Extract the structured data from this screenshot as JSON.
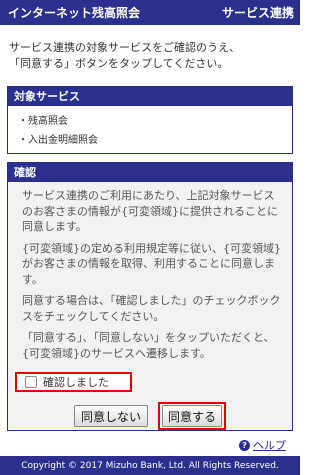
{
  "header": {
    "title": "インターネット残高照会",
    "right_label": "サービス連携"
  },
  "intro": {
    "line1": "サービス連携の対象サービスをご確認のうえ、",
    "line2": "「同意する」ボタンをタップしてください。"
  },
  "services_panel": {
    "heading": "対象サービス",
    "items": [
      "・残高照会",
      "・入出金明細照会"
    ]
  },
  "confirm_panel": {
    "heading": "確認",
    "para1": "サービス連携のご利用にあたり、上記対象サービスのお客さまの情報が{可変領域}に提供されることに同意します。",
    "para2": "{可変領域}の定める利用規定等に従い、{可変領域}がお客さまの情報を取得、利用することに同意します。",
    "para3": "同意する場合は、「確認しました」のチェックボックスをチェックしてください。",
    "para4": "「同意する」、「同意しない」をタップいただくと、{可変領域}のサービスへ遷移します。",
    "checkbox_label": "確認しました"
  },
  "buttons": {
    "disagree": "同意しない",
    "agree": "同意する"
  },
  "help": {
    "icon_glyph": "?",
    "label": "ヘルプ"
  },
  "footer": {
    "copyright": "Copyright © 2017 Mizuho Bank, Ltd. All Rights Reserved."
  },
  "colors": {
    "brand": "#2b2f8e",
    "highlight": "#e00000"
  }
}
